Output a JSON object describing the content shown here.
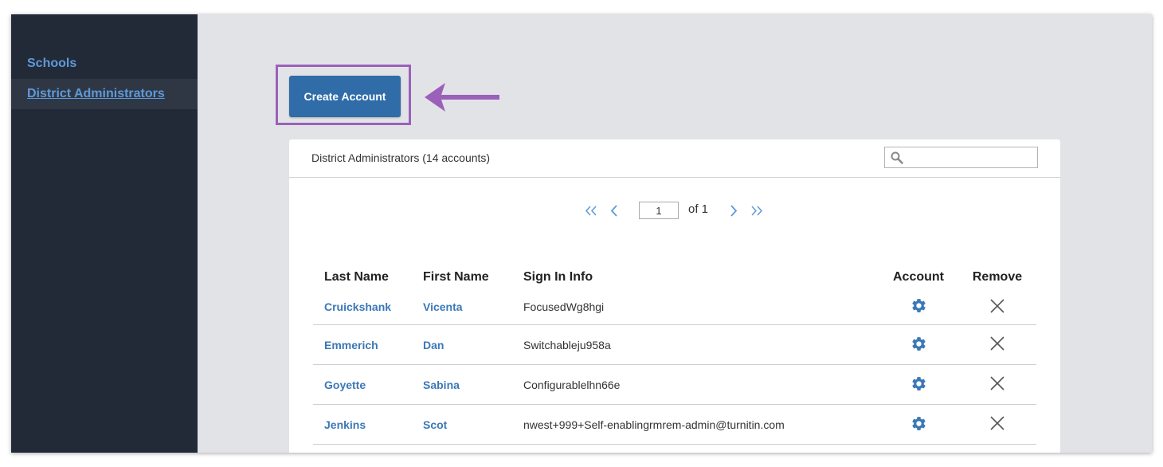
{
  "sidebar": {
    "items": [
      {
        "label": "Schools"
      },
      {
        "label": "District Administrators",
        "active": true
      }
    ]
  },
  "toolbar": {
    "create_label": "Create Account"
  },
  "card": {
    "title": "District Administrators (14 accounts)",
    "search": {
      "placeholder": "",
      "value": ""
    }
  },
  "pagination": {
    "current_page": "1",
    "of_label": "of 1"
  },
  "table": {
    "headers": {
      "last_name": "Last Name",
      "first_name": "First Name",
      "sign_in": "Sign In Info",
      "account": "Account",
      "remove": "Remove"
    },
    "rows": [
      {
        "last_name": "Cruickshank",
        "first_name": "Vicenta",
        "sign_in": "FocusedWg8hgi"
      },
      {
        "last_name": "Emmerich",
        "first_name": "Dan",
        "sign_in": "Switchableju958a"
      },
      {
        "last_name": "Goyette",
        "first_name": "Sabina",
        "sign_in": "Configurablelhn66e"
      },
      {
        "last_name": "Jenkins",
        "first_name": "Scot",
        "sign_in": "nwest+999+Self-enablingrmrem-admin@turnitin.com"
      }
    ]
  },
  "icons": {
    "account": "gear-icon",
    "remove": "close-icon",
    "search": "search-icon",
    "pager": [
      "double-chevron-left-icon",
      "chevron-left-icon",
      "chevron-right-icon",
      "double-chevron-right-icon"
    ]
  },
  "colors": {
    "sidebar_bg": "#222a38",
    "link": "#3b78b6",
    "button": "#2f6ca8",
    "annotation": "#9b61ba"
  }
}
